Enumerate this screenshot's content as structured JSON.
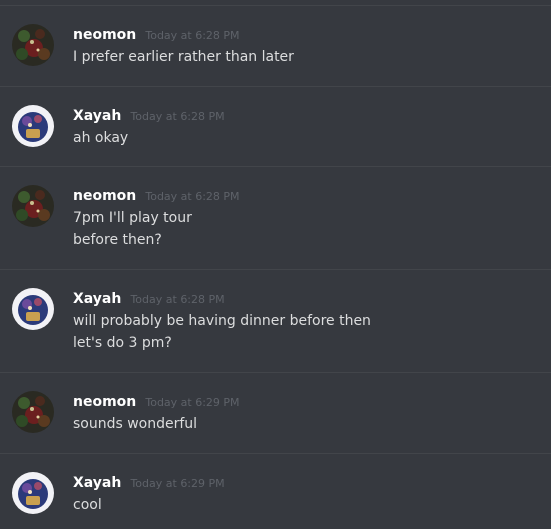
{
  "messages": [
    {
      "author": "neomon",
      "timestamp": "Today at 6:28 PM",
      "avatar": "neomon-avatar",
      "lines": [
        "I prefer earlier rather than later"
      ]
    },
    {
      "author": "Xayah",
      "timestamp": "Today at 6:28 PM",
      "avatar": "xayah-avatar",
      "lines": [
        "ah okay"
      ]
    },
    {
      "author": "neomon",
      "timestamp": "Today at 6:28 PM",
      "avatar": "neomon-avatar",
      "lines": [
        "7pm I'll play tour",
        "before then?"
      ]
    },
    {
      "author": "Xayah",
      "timestamp": "Today at 6:28 PM",
      "avatar": "xayah-avatar",
      "lines": [
        "will probably be having dinner before then",
        "let's do 3 pm?"
      ]
    },
    {
      "author": "neomon",
      "timestamp": "Today at 6:29 PM",
      "avatar": "neomon-avatar",
      "lines": [
        "sounds wonderful"
      ]
    },
    {
      "author": "Xayah",
      "timestamp": "Today at 6:29 PM",
      "avatar": "xayah-avatar",
      "lines": [
        "cool"
      ]
    }
  ],
  "colors": {
    "background": "#36393f",
    "divider": "#42454a",
    "username": "#ffffff",
    "timestamp": "#5e6269",
    "text": "#dcddde"
  }
}
